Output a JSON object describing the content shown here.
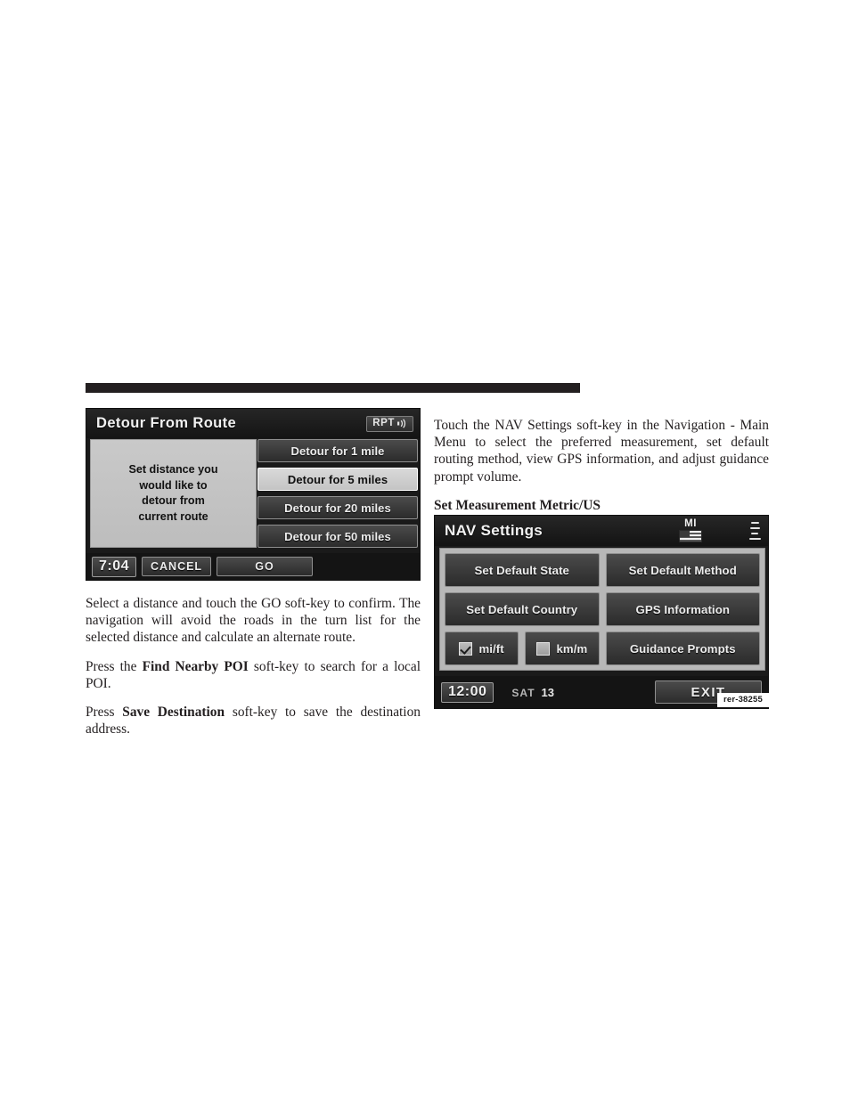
{
  "page": {
    "left_column": {
      "paragraphs": [
        {
          "id": "p-detour-instructions",
          "runs": [
            {
              "text": "Select a distance and touch the GO soft-key to confirm. The navigation will avoid the roads in the turn list for the selected distance and calculate an alternate route.",
              "bold": false
            }
          ]
        },
        {
          "id": "p-find-nearby-poi",
          "runs": [
            {
              "text": "Press the ",
              "bold": false
            },
            {
              "text": "Find Nearby POI",
              "bold": true
            },
            {
              "text": " soft-key to search for a local POI.",
              "bold": false
            }
          ]
        },
        {
          "id": "p-save-destination",
          "runs": [
            {
              "text": "Press ",
              "bold": false
            },
            {
              "text": "Save Destination",
              "bold": true
            },
            {
              "text": " soft-key to save the destination address.",
              "bold": false
            }
          ]
        }
      ]
    },
    "right_column": {
      "paragraphs": [
        {
          "id": "p-nav-settings-intro",
          "runs": [
            {
              "text": "Touch the NAV Settings soft-key in the Navigation - Main Menu to select the preferred measurement, set default routing method, view GPS information, and adjust guidance prompt volume.",
              "bold": false
            }
          ]
        }
      ],
      "subhead": "Set Measurement Metric/US"
    }
  },
  "detour_screen": {
    "title": "Detour From Route",
    "rpt_key": {
      "label": "RPT",
      "icon": "sound-waves-icon"
    },
    "message": "Set distance you would like to detour from current route",
    "message_lines": [
      "Set distance you",
      "would like to",
      "detour from",
      "current route"
    ],
    "distance_keys": [
      {
        "label": "Detour for 1 mile",
        "selected": false
      },
      {
        "label": "Detour for 5 miles",
        "selected": true
      },
      {
        "label": "Detour for 20 miles",
        "selected": false
      },
      {
        "label": "Detour for 50 miles",
        "selected": false
      }
    ],
    "status_bar": {
      "clock": "7:04",
      "cancel_label": "CANCEL",
      "go_label": "GO"
    }
  },
  "nav_settings_screen": {
    "title": "NAV Settings",
    "header_icons": {
      "state_abbrev": "MI",
      "flag_icon": "us-flag-icon",
      "scale_icon": "map-scale-icon"
    },
    "keys": [
      {
        "label": "Set Default State"
      },
      {
        "label": "Set Default Method"
      },
      {
        "label": "Set Default Country"
      },
      {
        "label": "GPS Information"
      }
    ],
    "measurement_options": [
      {
        "label": "mi/ft",
        "checked": true
      },
      {
        "label": "km/m",
        "checked": false
      }
    ],
    "guidance_key": {
      "label": "Guidance Prompts"
    },
    "status_bar": {
      "clock": "12:00",
      "day_of_week": "SAT",
      "day_number": "13",
      "exit_label": "EXIT"
    },
    "figure_code": "rer-38255"
  },
  "colors": {
    "page_background": "#ffffff",
    "text": "#231f20",
    "rule_bar": "#231f20",
    "screen_background": "#1a1a1a",
    "soft_key_face": "#3b3b3b",
    "soft_key_border": "#8f8f8f",
    "selected_key_face": "#cfcfcf",
    "panel_face": "#b7b7b7"
  }
}
